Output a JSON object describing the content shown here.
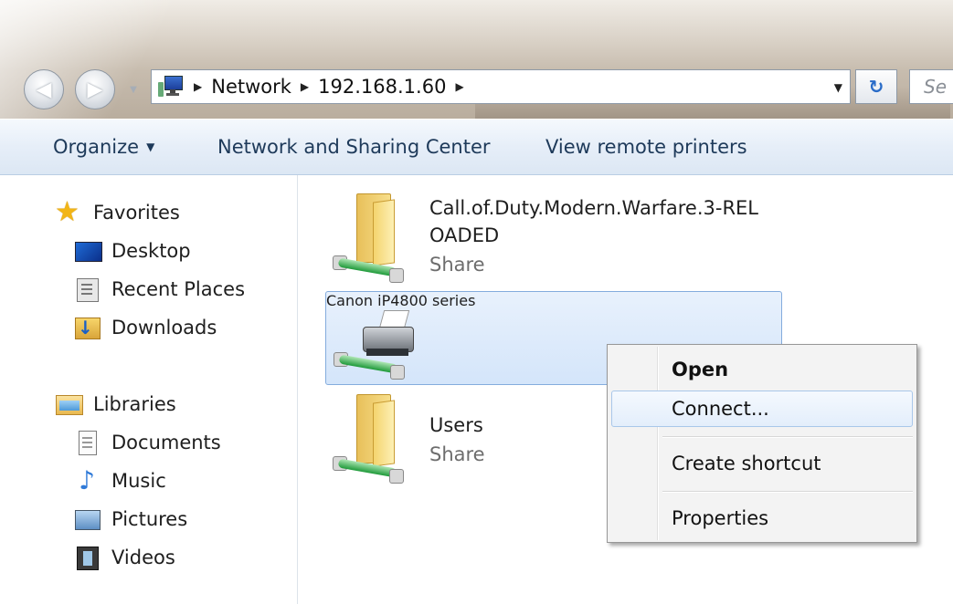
{
  "window": {
    "address": {
      "crumbs": [
        "Network",
        "192.168.1.60"
      ],
      "search_placeholder": "Se"
    },
    "command_bar": {
      "organize": "Organize",
      "network_sharing": "Network and Sharing Center",
      "view_printers": "View remote printers"
    },
    "nav": {
      "favorites": {
        "label": "Favorites",
        "items": [
          "Desktop",
          "Recent Places",
          "Downloads"
        ]
      },
      "libraries": {
        "label": "Libraries",
        "items": [
          "Documents",
          "Music",
          "Pictures",
          "Videos"
        ]
      }
    },
    "content": {
      "items": [
        {
          "name_line1": "Call.of.Duty.Modern.Warfare.3-REL",
          "name_line2": "OADED",
          "type": "Share",
          "icon": "shared-folder-icon"
        },
        {
          "name_line1": "Canon iP4800 series",
          "type": "",
          "icon": "shared-printer-icon"
        },
        {
          "name_line1": "Users",
          "type": "Share",
          "icon": "shared-folder-icon"
        }
      ]
    },
    "context_menu": {
      "items": [
        "Open",
        "Connect...",
        "Create shortcut",
        "Properties"
      ]
    }
  }
}
